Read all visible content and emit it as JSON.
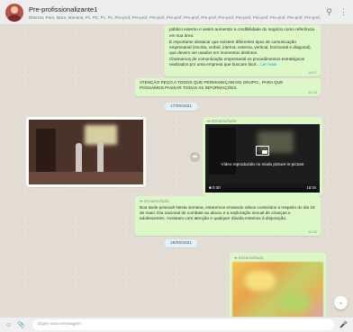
{
  "header": {
    "title": "Pre-profissionalizante1",
    "participants": "Eberton, Pam, Mara, Mariana, Pc, PC, Pc, Pc, Pre-prof, Pre-prof, Pre-prof, Pre-prof, Pre-prof, Pre-prof, Pre-prof, Pre-prof, Pre-prof, Pre-prof, Pre-prof, Pre-prof, Pre-prof, Voce",
    "icons": [
      "search-icon",
      "menu-icon"
    ]
  },
  "messages": {
    "long_text": {
      "lines": [
        "público externo e assim aumentar a credibilidade do negócio como referência",
        "em sua área."
      ],
      "para2": "É importante destacar que existem diferentes tipos de comunicação empresarial (escrita, verbal, interna, externa, vertical, horizontal e diagonal), que devem ser usados em momentos distintos.",
      "para3_start": "Chamamos de comunicação empresarial os procedimentos estratégicos realizados por uma empresa que buscam facil...",
      "see_more": "Ler mais",
      "time": "16:07"
    },
    "attention": {
      "text": "ATENÇÃO PEÇO A TODOS QUE PERMANEÇAM NO GRUPO , PARA QUE POSSAMOS PASSAR TODAS AS INFORMAÇÕES",
      "time": "16:18"
    },
    "date1": "17/05/2021",
    "forwarded_label": "Encaminhada",
    "video2": {
      "pip_text": "Vídeo reproduzido no modo picture-in-picture",
      "duration": "0:30",
      "time": "16:34"
    },
    "forwarded_text": {
      "text": "Boa tarde pessoal! Nesta semana, estaremos enviando vários conteúdos a respeito do dia 18 de maio: Dia nacional de combate ao abuso e a exploração sexual de crianças e adolescentes. Assistam com atenção e qualquer dúvida estamos à disposição.",
      "time": "16:35"
    },
    "date2": "18/05/2021"
  },
  "footer": {
    "placeholder": "Digite uma mensagem"
  },
  "colors": {
    "outgoing_bubble": "#dcf8c6",
    "chat_background": "#e4ddd3",
    "header": "#ededed",
    "link": "#039be5"
  }
}
